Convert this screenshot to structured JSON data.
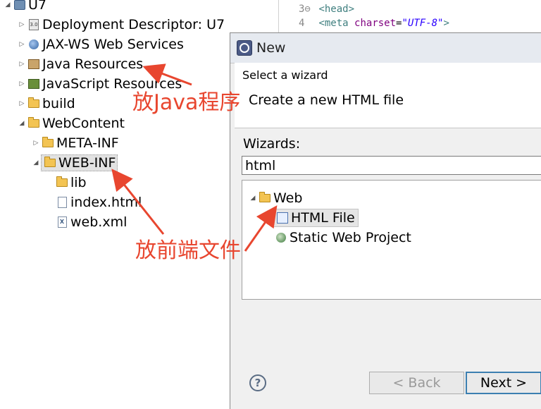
{
  "project_explorer": {
    "items": [
      {
        "label": "U7"
      },
      {
        "label": "Deployment Descriptor: U7"
      },
      {
        "label": "JAX-WS Web Services"
      },
      {
        "label": "Java Resources"
      },
      {
        "label": "JavaScript Resources"
      },
      {
        "label": "build"
      },
      {
        "label": "WebContent"
      },
      {
        "label": "META-INF"
      },
      {
        "label": "WEB-INF"
      },
      {
        "label": "lib"
      },
      {
        "label": "index.html"
      },
      {
        "label": "web.xml"
      }
    ],
    "dd_icon_text": "3.0",
    "xml_icon_text": "X"
  },
  "editor": {
    "lines": [
      {
        "num": "3⊖",
        "tag_open": "<head>"
      },
      {
        "num": "4",
        "tag": "<meta",
        "attr": "charset",
        "eq": "=",
        "value": "\"UTF-8\"",
        "close": ">"
      }
    ]
  },
  "dialog": {
    "title": "New",
    "banner_title": "Select a wizard",
    "banner_desc": "Create a new HTML file",
    "wizards_label": "Wizards:",
    "filter_value": "html",
    "tree": [
      {
        "label": "Web"
      },
      {
        "label": "HTML File"
      },
      {
        "label": "Static Web Project"
      }
    ],
    "help_symbol": "?",
    "back_label": "< Back",
    "next_label": "Next >"
  },
  "annotations": {
    "java_note": "放Java程序",
    "frontend_note": "放前端文件",
    "color": "#e8462f"
  }
}
